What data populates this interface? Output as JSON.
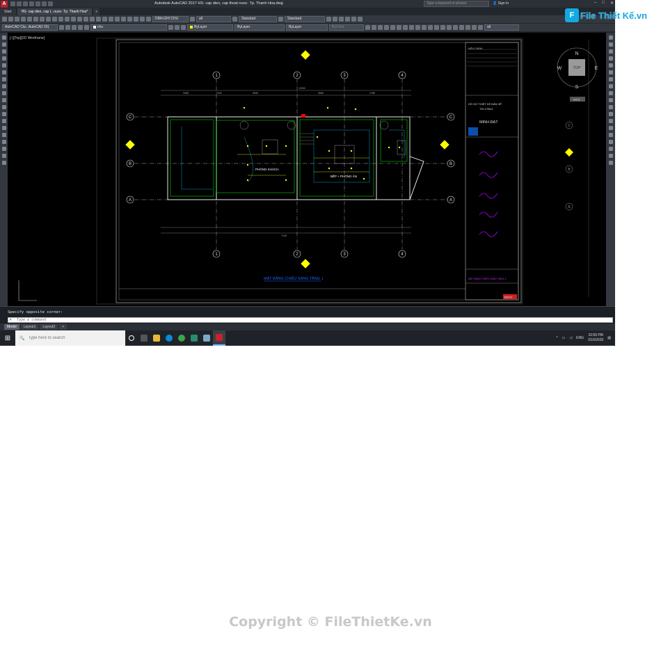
{
  "window": {
    "title": "Autodesk AutoCAD 2017   HS- cap dien, cap thoat nuoc- Tp. Thanh Hoa.dwg",
    "search_placeholder": "Type a keyword or phrase",
    "signin": "Sign In",
    "controls": [
      "–",
      "□",
      "✕"
    ]
  },
  "tabs": [
    {
      "label": "Start"
    },
    {
      "label": "HS- cap dien, cap t...nuoc- Tp. Thanh Hoa*"
    },
    {
      "label": "+"
    }
  ],
  "toolbar1": {
    "dim_style": "DIM+GHI CHU",
    "layer_filter": "all",
    "text_style": "Standard",
    "table_style": "Standard"
  },
  "toolbar2": {
    "workspace": "AutoCAD Cla...AutoCAD 20(",
    "layer": "chu",
    "color": "ByLayer",
    "linetype": "ByLayer",
    "lineweight": "ByLayer",
    "plotstyle": "ByColor",
    "filter": "all"
  },
  "viewport": {
    "label": "[–][Top][2D Wireframe]"
  },
  "viewcube": {
    "top": "TOP",
    "n": "N",
    "s": "S",
    "e": "E",
    "w": "W",
    "wcs": "WCS"
  },
  "drawing": {
    "grid_numbers": [
      "1",
      "2",
      "3",
      "4"
    ],
    "grid_letters": [
      "C",
      "B",
      "A"
    ],
    "rooms": [
      "PHÒNG KHÁCH",
      "BẾP + PHÒNG ĂN"
    ],
    "sheet_title": "MẶT BẰNG CHIẾU SÁNG TẦNG 1",
    "dims_top": [
      "3285",
      "1220",
      "3945",
      "3665",
      "1785"
    ],
    "dim_total": "12000",
    "dim_bottom_total": "7146"
  },
  "titleblock": {
    "revision_header": "HIỆU CHỈNH",
    "project_label": "HỒ SƠ THIẾT KẾ BẢN VẼ",
    "stage": "THI CÔNG",
    "company": "MINH ĐẠT",
    "drawing_name": "MẶT BẰNG CHIẾU SÁNG TẦNG 1",
    "sheet_no": "E02-01"
  },
  "command": {
    "history": "Specify opposite corner:",
    "placeholder": "Type a command",
    "close": "✕"
  },
  "layout_tabs": [
    {
      "label": "Model"
    },
    {
      "label": "Layout1"
    },
    {
      "label": "Layout2"
    },
    {
      "label": "+"
    }
  ],
  "taskbar": {
    "search_placeholder": "Type here to search",
    "language": "ENG",
    "time": "10:50 PM",
    "date": "3/16/2020"
  },
  "watermark": {
    "logo_text": "File Thiết Kế.vn",
    "logo_letter": "F",
    "copyright": "Copyright © FileThietKe.vn"
  },
  "colors": {
    "canvas": "#000000",
    "ui_dark": "#33383f",
    "accent_yellow": "#ffff00",
    "accent_cyan": "#00ffff",
    "accent_green": "#00ff00",
    "brand_blue": "#16a7df",
    "autocad_red": "#b8202b"
  }
}
